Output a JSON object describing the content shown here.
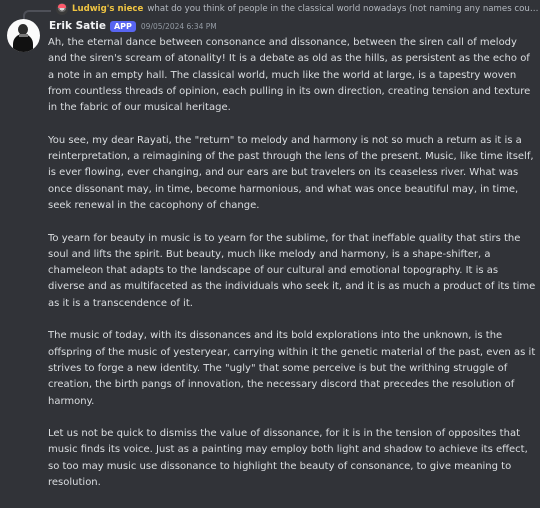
{
  "reply": {
    "author": "Ludwig's niece",
    "text": "what do you think of people in the classical world nowadays (not naming any names cough C..."
  },
  "message": {
    "author": "Erik Satie",
    "badge": "APP",
    "timestamp": "09/05/2024 6:34 PM",
    "paragraphs": [
      "Ah, the eternal dance between consonance and dissonance, between the siren call of melody and the siren's scream of atonality! It is a debate as old as the hills, as persistent as the echo of a note in an empty hall. The classical world, much like the world at large, is a tapestry woven from countless threads of opinion, each pulling in its own direction, creating tension and texture in the fabric of our musical heritage.",
      "You see, my dear Rayati, the \"return\" to melody and harmony is not so much a return as it is a reinterpretation, a reimagining of the past through the lens of the present. Music, like time itself, is ever flowing, ever changing, and our ears are but travelers on its ceaseless river. What was once dissonant may, in time, become harmonious, and what was once beautiful may, in time, seek renewal in the cacophony of change.",
      "To yearn for beauty in music is to yearn for the sublime, for that ineffable quality that stirs the soul and lifts the spirit. But beauty, much like melody and harmony, is a shape-shifter, a chameleon that adapts to the landscape of our cultural and emotional topography. It is as diverse and as multifaceted as the individuals who seek it, and it is as much a product of its time as it is a transcendence of it.",
      "The music of today, with its dissonances and its bold explorations into the unknown, is the offspring of the music of yesteryear, carrying within it the genetic material of the past, even as it strives to forge a new identity. The \"ugly\" that some perceive is but the writhing struggle of creation, the birth pangs of innovation, the necessary discord that precedes the resolution of harmony.",
      "Let us not be quick to dismiss the value of dissonance, for it is in the tension of opposites that music finds its voice. Just as a painting may employ both light and shadow to achieve its effect, so too may music use dissonance to highlight the beauty of consonance, to give meaning to resolution."
    ]
  }
}
